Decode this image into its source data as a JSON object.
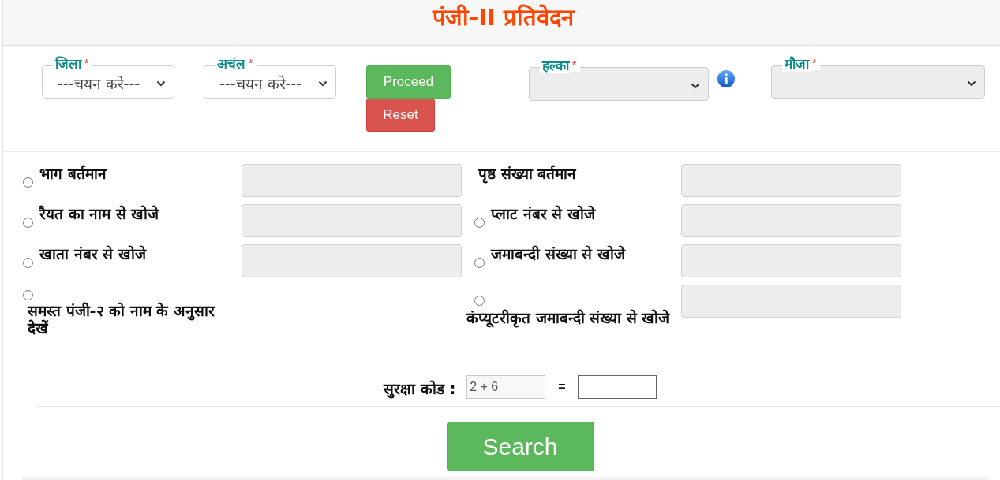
{
  "header": {
    "title": "पंजी-II प्रतिवेदन"
  },
  "location_filters": [
    {
      "label": "जिला",
      "required_mark": "*",
      "value": "---चयन करे---",
      "disabled": false,
      "info": false
    },
    {
      "label": "अचंल",
      "required_mark": "*",
      "value": "---चयन करे---",
      "disabled": false,
      "info": false
    },
    {
      "label": "हल्का",
      "required_mark": "*",
      "disabled": true,
      "info": true
    },
    {
      "label": "मौजा",
      "required_mark": "*",
      "disabled": true,
      "info": false
    }
  ],
  "actions": [
    {
      "label": "Proceed",
      "kind": "proceed"
    },
    {
      "label": "Reset",
      "kind": "reset"
    }
  ],
  "search_options": [
    {
      "kind": "radio",
      "label": "भाग बर्तमान",
      "selected": false,
      "field": true
    },
    {
      "kind": "plain",
      "label": "पृष्ठ संख्या बर्तमान",
      "field": true
    },
    {
      "kind": "radio",
      "label": "रैयत का नाम से खोजे",
      "selected": false,
      "field": true
    },
    {
      "kind": "radio",
      "label": "प्लाट नंबर से खोजे",
      "selected": false,
      "field": true
    },
    {
      "kind": "radio",
      "label": "खाता नंबर से खोजे",
      "selected": false,
      "field": true
    },
    {
      "kind": "radio",
      "label": "जमाबन्दी संख्या से खोजे",
      "selected": false,
      "field": true
    },
    {
      "kind": "stacked",
      "label": "समस्त पंजी-२ को नाम के अनुसार देखें",
      "selected": false,
      "field": false
    },
    {
      "kind": "stacked",
      "label": "कंप्यूटरीकृत जमाबन्दी संख्या से खोजे",
      "selected": false,
      "field": true
    }
  ],
  "security": {
    "label": "सुरक्षा कोड :",
    "captcha": "2 + 6",
    "equals": "="
  },
  "search_button": {
    "label": "Search"
  }
}
